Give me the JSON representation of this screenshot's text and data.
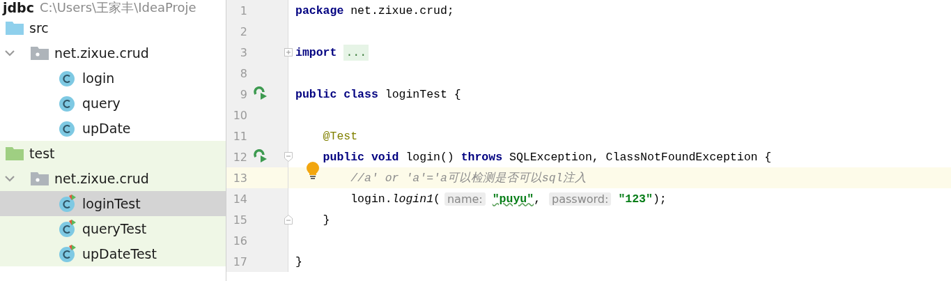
{
  "project": {
    "name": "jdbc",
    "path": "C:\\Users\\王家丰\\IdeaProje"
  },
  "tree": [
    {
      "label": "src",
      "kind": "source_root",
      "children": [
        {
          "label": "net.zixue.crud",
          "kind": "package",
          "expanded": true,
          "children": [
            {
              "label": "login",
              "kind": "class",
              "selected": false
            },
            {
              "label": "query",
              "kind": "class",
              "selected": false
            },
            {
              "label": "upDate",
              "kind": "class",
              "selected": false
            }
          ]
        }
      ]
    },
    {
      "label": "test",
      "kind": "test_root",
      "children": [
        {
          "label": "net.zixue.crud",
          "kind": "package",
          "expanded": true,
          "children": [
            {
              "label": "loginTest",
              "kind": "test_class",
              "selected": true
            },
            {
              "label": "queryTest",
              "kind": "test_class",
              "selected": false
            },
            {
              "label": "upDateTest",
              "kind": "test_class",
              "selected": false
            }
          ]
        }
      ]
    }
  ],
  "editor": {
    "lines": [
      {
        "number": "1",
        "tokens": [
          {
            "kind": "keyword",
            "text": "package"
          },
          {
            "kind": "plain",
            "text": " net.zixue.crud;"
          }
        ]
      },
      {
        "number": "2"
      },
      {
        "number": "3",
        "collapsed": true,
        "tokens": [
          {
            "kind": "keyword",
            "text": "import"
          },
          {
            "kind": "folded",
            "text": "..."
          }
        ]
      },
      {
        "number": "8"
      },
      {
        "number": "9",
        "run": true,
        "tokens": [
          {
            "kind": "keyword",
            "text": "public class"
          },
          {
            "kind": "plain",
            "text": " loginTest {"
          }
        ]
      },
      {
        "number": "10"
      },
      {
        "number": "11",
        "tokens": [
          {
            "kind": "annotation",
            "text": "    @Test"
          }
        ]
      },
      {
        "number": "12",
        "run": true,
        "fold_start": true,
        "tokens": [
          {
            "kind": "keyword",
            "text": "    public void"
          },
          {
            "kind": "plain",
            "text": " login() "
          },
          {
            "kind": "keyword",
            "text": "throws"
          },
          {
            "kind": "plain",
            "text": " SQLException, ClassNotFoundException {"
          }
        ]
      },
      {
        "number": "13",
        "current": true,
        "bulb": true,
        "tokens": [
          {
            "kind": "comment",
            "text": "        //a' or 'a'='a可以检测是否可以sql注入"
          }
        ]
      },
      {
        "number": "14",
        "tokens": [
          {
            "kind": "plain",
            "text": "        login."
          },
          {
            "kind": "call",
            "text": "login1"
          },
          {
            "kind": "plain",
            "text": "("
          },
          {
            "kind": "hint",
            "text": "name:"
          },
          {
            "kind": "string_typo",
            "text": "\"puyu\""
          },
          {
            "kind": "plain",
            "text": ","
          },
          {
            "kind": "hint",
            "text": "password:"
          },
          {
            "kind": "string",
            "text": "\"123\""
          },
          {
            "kind": "plain",
            "text": ");"
          }
        ]
      },
      {
        "number": "15",
        "fold_end": true,
        "tokens": [
          {
            "kind": "plain",
            "text": "    }"
          }
        ]
      },
      {
        "number": "16"
      },
      {
        "number": "17",
        "tokens": [
          {
            "kind": "plain",
            "text": "}"
          }
        ]
      }
    ]
  }
}
